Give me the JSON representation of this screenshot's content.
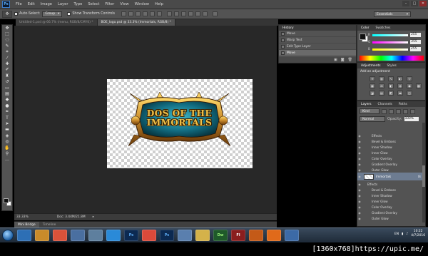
{
  "menubar": {
    "logo": "Ps",
    "items": [
      "File",
      "Edit",
      "Image",
      "Layer",
      "Type",
      "Select",
      "Filter",
      "View",
      "Window",
      "Help"
    ]
  },
  "options": {
    "auto_select_label": "Auto-Select:",
    "auto_select_value": "Group",
    "transform_label": "Show Transform Controls",
    "workspace": "Essentials"
  },
  "tabs": [
    {
      "label": "Untitled-1.psd @ 66.7% (menu, RGB/8/CMYK) *",
      "active": false
    },
    {
      "label": "BOE_logo.psd @ 33.3% (Immortals, RGB/8) *",
      "active": true
    }
  ],
  "canvas": {
    "logo_line1": "DOS OF THE",
    "logo_line2": "IMMORTALS"
  },
  "status": {
    "zoom": "33.33%",
    "doc_size": "Doc: 3.44M/21.8M"
  },
  "bridge": {
    "tab1": "Mini Bridge",
    "tab2": "Timeline"
  },
  "history": {
    "tab1": "History",
    "rows": [
      "Move",
      "Warp Text",
      "Edit Type Layer",
      "Move"
    ]
  },
  "color_panel": {
    "tab1": "Color",
    "tab2": "Swatches",
    "r_label": "R",
    "r_val": "255",
    "g_label": "G",
    "g_val": "255",
    "b_label": "B",
    "b_val": "255"
  },
  "adjustments": {
    "tab1": "Adjustments",
    "tab2": "Styles",
    "header": "Add an adjustment"
  },
  "layers": {
    "tab1": "Layers",
    "tab2": "Channels",
    "tab3": "Paths",
    "kind": "Kind",
    "blend": "Normal",
    "opacity_label": "Opacity:",
    "opacity_val": "100%",
    "rows": [
      {
        "label": "Effects",
        "type": "fx"
      },
      {
        "label": "Bevel & Emboss",
        "type": "fx"
      },
      {
        "label": "Inner Shadow",
        "type": "fx"
      },
      {
        "label": "Inner Glow",
        "type": "fx"
      },
      {
        "label": "Color Overlay",
        "type": "fx"
      },
      {
        "label": "Gradient Overlay",
        "type": "fx"
      },
      {
        "label": "Outer Glow",
        "type": "fx"
      },
      {
        "label": "Immortals",
        "type": "layer"
      },
      {
        "label": "Effects",
        "type": "fx"
      },
      {
        "label": "Bevel & Emboss",
        "type": "fx"
      },
      {
        "label": "Inner Shadow",
        "type": "fx"
      },
      {
        "label": "Inner Glow",
        "type": "fx"
      },
      {
        "label": "Color Overlay",
        "type": "fx"
      },
      {
        "label": "Gradient Overlay",
        "type": "fx"
      },
      {
        "label": "Outer Glow",
        "type": "fx"
      }
    ]
  },
  "taskbar": {
    "apps": [
      {
        "label": "",
        "color": "#2d6fb5"
      },
      {
        "label": "",
        "color": "#c98b2a"
      },
      {
        "label": "",
        "color": "#d9523a"
      },
      {
        "label": "",
        "color": "#4a6fa0"
      },
      {
        "label": "",
        "color": "#5e7f9e"
      },
      {
        "label": "",
        "color": "#2a8ad8"
      },
      {
        "label": "Ps",
        "color": "#0c2a52"
      },
      {
        "label": "",
        "color": "#db4a3a"
      },
      {
        "label": "Ps",
        "color": "#0c2a52"
      },
      {
        "label": "",
        "color": "#5a7fae"
      },
      {
        "label": "",
        "color": "#d4b24a"
      },
      {
        "label": "Dw",
        "color": "#1f5a2a"
      },
      {
        "label": "Fl",
        "color": "#8a1e1e"
      },
      {
        "label": "",
        "color": "#c45a18"
      },
      {
        "label": "",
        "color": "#e06a1a"
      },
      {
        "label": "",
        "color": "#3c6aa6"
      }
    ],
    "lang": "EN",
    "time": "10:22",
    "date": "4/7/2016"
  },
  "watermark": "[1360x768]https://upic.me/"
}
